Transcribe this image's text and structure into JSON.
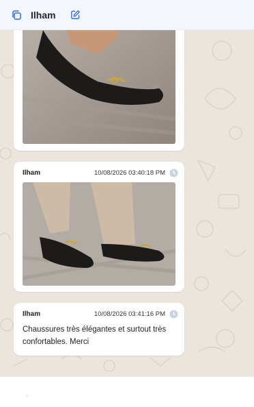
{
  "header": {
    "copy_icon": "copy-icon",
    "title": "Ilham",
    "edit_icon": "edit-icon"
  },
  "messages": [
    {
      "image_description": "black loafer with gold horsebit on rug"
    },
    {
      "sender": "Ilham",
      "timestamp": "10/08/2026 03:40:18 PM",
      "status_icon": "clock-icon"
    },
    {
      "sender": "Ilham",
      "timestamp": "10/08/2026 03:41:16 PM",
      "status_icon": "clock-icon",
      "text": "Chaussures très élégantes et surtout très confortables.  Merci"
    }
  ],
  "colors": {
    "chat_background": "#ece5dd",
    "accent": "#2a6ff2",
    "bubble": "#ffffff"
  }
}
